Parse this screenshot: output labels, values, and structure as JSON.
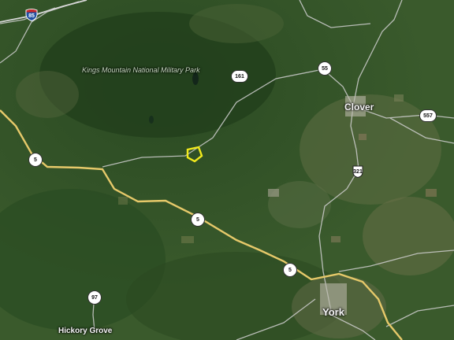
{
  "map": {
    "labels": {
      "park": "Kings Mountain National Military Park",
      "clover": "Clover",
      "york": "York",
      "hickory_grove": "Hickory Grove"
    },
    "shields": {
      "i85": "85",
      "sc161": "161",
      "sc55": "55",
      "sc557": "557",
      "us321": "321",
      "sc5_west": "5",
      "sc5_mid": "5",
      "sc5_east": "5",
      "sc97": "97"
    },
    "colors": {
      "highway": "#e6c96a",
      "road": "#d8d8d8",
      "parcel_outline": "#f2ea1c"
    }
  }
}
